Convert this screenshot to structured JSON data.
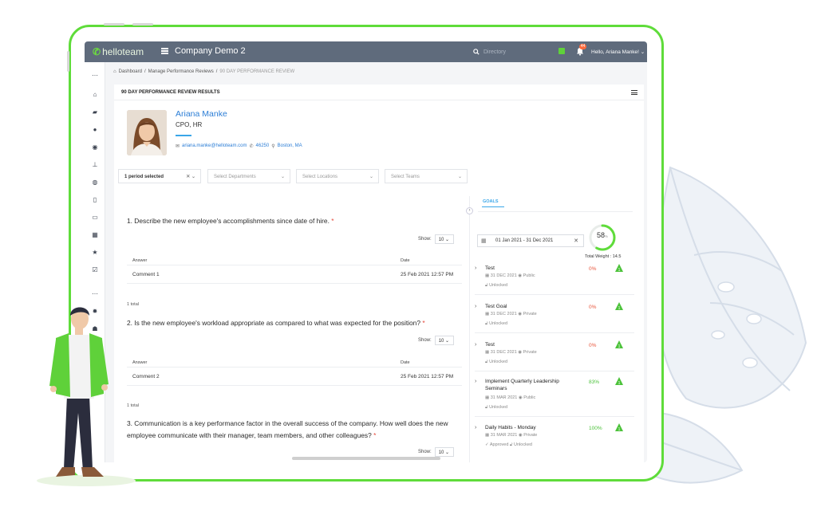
{
  "app": {
    "logo": "helloteam",
    "company": "Company Demo 2",
    "search_placeholder": "Directory",
    "notification_count": "44",
    "user_greeting": "Hello, Ariana Manke! ⌄"
  },
  "breadcrumb": [
    "Dashboard",
    "Manage Performance Reviews",
    "90 DAY PERFORMANCE REVIEW"
  ],
  "panel": {
    "title": "90 DAY PERFORMANCE REVIEW RESULTS"
  },
  "profile": {
    "name": "Ariana Manke",
    "role": "CPO, HR",
    "email": "ariana.manke@helloteam.com",
    "phone": "46250",
    "location": "Boston, MA"
  },
  "filters": {
    "period": "1 period selected",
    "departments": "Select Departments",
    "locations": "Select Locations",
    "teams": "Select Teams"
  },
  "questions": [
    {
      "text": "1. Describe the new employee's accomplishments since date of hire.",
      "show_label": "Show:",
      "show_value": "10",
      "columns": [
        "Answer",
        "Date"
      ],
      "rows": [
        {
          "answer": "Comment 1",
          "date": "25 Feb 2021 12:57 PM"
        }
      ],
      "total": "1 total"
    },
    {
      "text": "2. Is the new employee's workload appropriate as compared to what was expected for the position?",
      "show_label": "Show:",
      "show_value": "10",
      "columns": [
        "Answer",
        "Date"
      ],
      "rows": [
        {
          "answer": "Comment 2",
          "date": "25 Feb 2021 12:57 PM"
        }
      ],
      "total": "1 total"
    },
    {
      "text": "3. Communication is a key performance factor in the overall success of the company. How well does the new employee communicate with their manager, team members, and other colleagues?",
      "show_label": "Show:",
      "show_value": "10"
    }
  ],
  "goals": {
    "tab": "GOALS",
    "date_range": "01 Jan 2021 - 31 Dec 2021",
    "score": "58",
    "score_unit": "%",
    "score_fraction": 0.58,
    "total_weight": "Total Weight : 14.5",
    "items": [
      {
        "title": "Test",
        "date": "31 DEC 2021",
        "visibility": "Public",
        "status": "Unlocked",
        "approved": "",
        "pct": "0%",
        "pct_color": "#e8553b"
      },
      {
        "title": "Test Goal",
        "date": "31 DEC 2021",
        "visibility": "Private",
        "status": "Unlocked",
        "approved": "",
        "pct": "0%",
        "pct_color": "#e8553b"
      },
      {
        "title": "Test",
        "date": "31 DEC 2021",
        "visibility": "Private",
        "status": "Unlocked",
        "approved": "",
        "pct": "0%",
        "pct_color": "#e8553b"
      },
      {
        "title": "Implement Quarterly Leadership Seminars",
        "date": "31 MAR 2021",
        "visibility": "Public",
        "status": "Unlocked",
        "approved": "",
        "pct": "83%",
        "pct_color": "#4cc23a"
      },
      {
        "title": "Daily Habits - Monday",
        "date": "31 MAR 2021",
        "visibility": "Private",
        "status": "Unlocked",
        "approved": "Approved",
        "pct": "100%",
        "pct_color": "#4cc23a"
      }
    ]
  },
  "colors": {
    "accent_green": "#5fdc3a",
    "topbar": "#5f6b7c",
    "link_blue": "#2c7ed6"
  }
}
